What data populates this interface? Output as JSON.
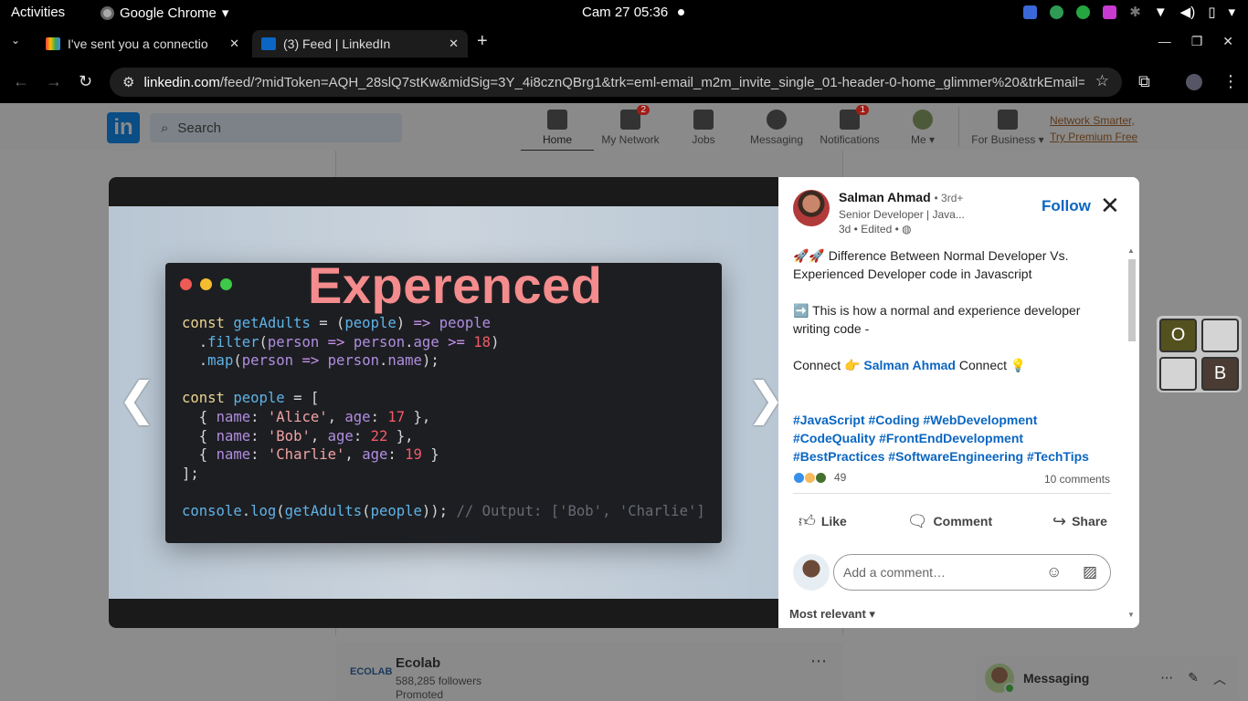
{
  "system": {
    "activities": "Activities",
    "app_name": "Google Chrome",
    "clock": "Cam 27  05:36"
  },
  "browser": {
    "tabs": [
      {
        "title": "I've sent you a connectio",
        "favicon": "gmail-icon"
      },
      {
        "title": "(3) Feed | LinkedIn",
        "favicon": "linkedin-icon"
      }
    ],
    "url_host": "linkedin.com",
    "url_rest": "/feed/?midToken=AQH_28slQ7stKw&midSig=3Y_4i8cznQBrg1&trk=eml-email_m2m_invite_single_01-header-0-home_glimmer%20&trkEmail=eml-e..."
  },
  "linkedin": {
    "logo": "in",
    "search_placeholder": "Search",
    "nav": [
      {
        "label": "Home",
        "badge": ""
      },
      {
        "label": "My Network",
        "badge": "2"
      },
      {
        "label": "Jobs",
        "badge": ""
      },
      {
        "label": "Messaging",
        "badge": ""
      },
      {
        "label": "Notifications",
        "badge": "1"
      },
      {
        "label": "Me ▾",
        "badge": ""
      },
      {
        "label": "For Business ▾",
        "badge": ""
      }
    ],
    "premium_line1": "Network Smarter,",
    "premium_line2": "Try Premium Free"
  },
  "code_image": {
    "title": "Experenced"
  },
  "post": {
    "author": "Salman Ahmad",
    "degree": "• 3rd+",
    "headline": "Senior Developer | Java...",
    "meta": "3d • Edited •",
    "follow_label": "Follow",
    "line1": "🚀🚀 Difference Between Normal Developer Vs. Experienced Developer code in Javascript",
    "line2": "➡️ This is how a normal and experience developer writing code -",
    "connect_prefix": "Connect 👉",
    "connect_mention": "Salman Ahmad",
    "connect_suffix": "Connect 💡",
    "hashtags": "#JavaScript #Coding #WebDevelopment #CodeQuality #FrontEndDevelopment #BestPractices #SoftwareEngineering #TechTips",
    "reaction_count": "49",
    "comments_count": "10 comments",
    "actions": {
      "like": "Like",
      "comment": "Comment",
      "share": "Share"
    },
    "comment_placeholder": "Add a comment…",
    "sort_label": "Most relevant ▾"
  },
  "feed": {
    "company": "Ecolab",
    "company_logo": "ECOLAB",
    "followers": "588,285 followers",
    "promoted": "Promoted"
  },
  "widget": {
    "left_top": "O",
    "right_bottom": "B"
  },
  "messaging": {
    "label": "Messaging"
  },
  "colors": {
    "linkedin_blue": "#0a66c2",
    "code_bg": "#1d1e22",
    "title_pink": "#f48b8c"
  }
}
